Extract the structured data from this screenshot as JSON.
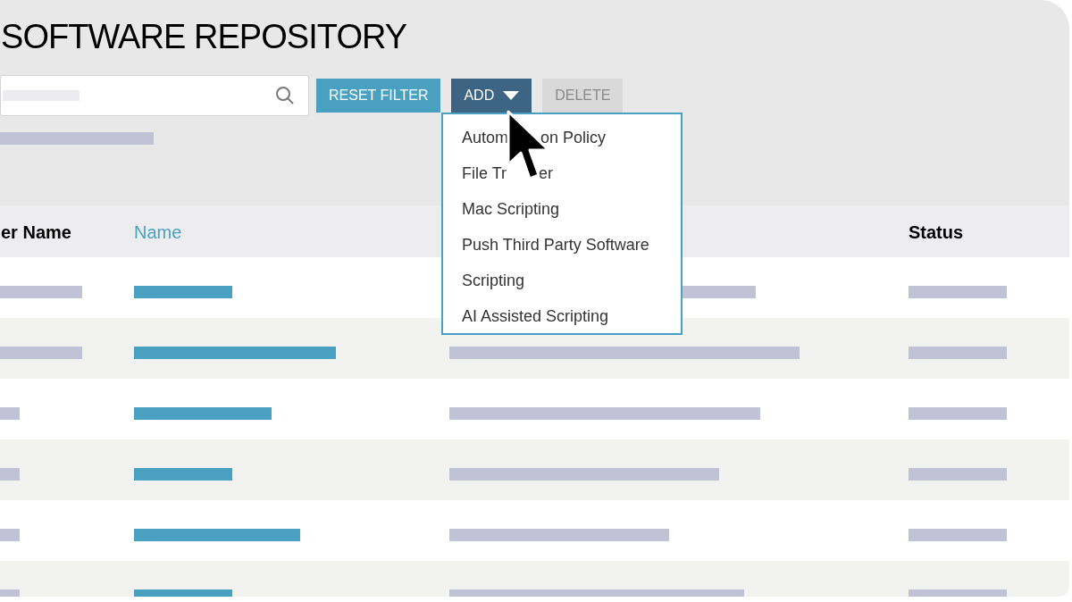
{
  "title": "SOFTWARE REPOSITORY",
  "toolbar": {
    "buttons": [
      {
        "label": "RESET FILTER",
        "kind": "primary",
        "disabled": false
      },
      {
        "label": "ADD",
        "kind": "dropdown",
        "disabled": false,
        "expanded": true
      },
      {
        "label": "DELETE",
        "kind": "primary",
        "disabled": true
      }
    ]
  },
  "add_menu": {
    "items": [
      {
        "label": "Autom",
        "label_end": "on Policy"
      },
      {
        "label": "File Tr",
        "label_end": "er"
      },
      {
        "label": "Mac Scripting"
      },
      {
        "label": "Push Third Party Software"
      },
      {
        "label": "Scripting"
      },
      {
        "label": "AI Assisted Scripting"
      }
    ]
  },
  "table": {
    "columns": [
      {
        "label": "er Name",
        "selected": false
      },
      {
        "label": "Name",
        "selected": true
      },
      {
        "label": "Status",
        "selected": false
      }
    ]
  }
}
